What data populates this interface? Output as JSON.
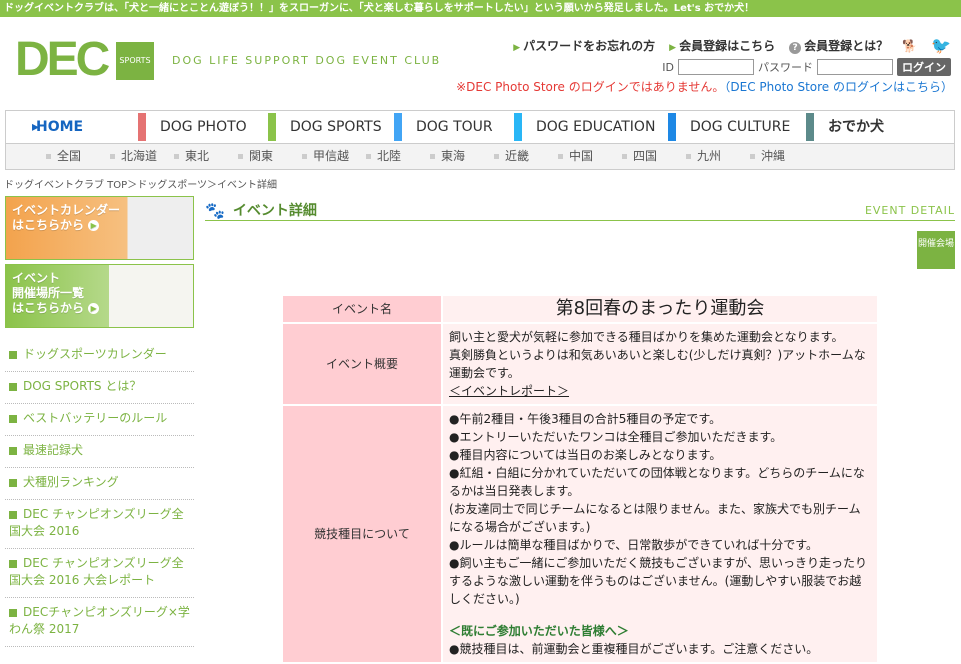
{
  "topbar": {
    "text": "ドッグイベントクラブは、「犬と一緒にとことん遊ぼう！！」をスローガンに、「犬と楽しむ暮らしをサポートしたい」という願いから発足しました。Let's おでか犬！"
  },
  "logo": {
    "main": "DEC",
    "badge": "SPORTS"
  },
  "tagline": "DOG LIFE SUPPORT DOG EVENT CLUB",
  "header": {
    "forgot": "パスワードをお忘れの方",
    "register": "会員登録はこちら",
    "what": "会員登録とは？",
    "id_label": "ID",
    "pw_label": "パスワード",
    "login": "ログイン",
    "warn_red": "※DEC Photo Store のログインではありません。",
    "warn_blue": "（DEC Photo Store のログインはこちら）"
  },
  "nav": {
    "items": [
      "HOME",
      "DOG PHOTO",
      "DOG SPORTS",
      "DOG TOUR",
      "DOG EDUCATION",
      "DOG CULTURE",
      "おでか犬"
    ],
    "regions": [
      "全国",
      "北海道",
      "東北",
      "関東",
      "甲信越",
      "北陸",
      "東海",
      "近畿",
      "中国",
      "四国",
      "九州",
      "沖縄"
    ]
  },
  "breadcrumb": "ドッグイベントクラブ TOP＞ドッグスポーツ＞イベント詳細",
  "banners": {
    "calendar_1": "イベントカレンダー",
    "calendar_2": "はこちらから",
    "venue_1": "イベント",
    "venue_2": "開催場所一覧",
    "venue_3": "はこちらから"
  },
  "sidebar": [
    "ドッグスポーツカレンダー",
    "DOG SPORTS とは？",
    "ベストバッテリーのルール",
    "最速記録犬",
    "犬種別ランキング",
    "DEC チャンピオンズリーグ全国大会 2016",
    "DEC チャンピオンズリーグ全国大会 2016 大会レポート",
    "DECチャンピオンズリーグ×学わん祭 2017"
  ],
  "main": {
    "title": "イベント詳細",
    "title_en": "EVENT DETAIL",
    "venue_badge": "開催会場"
  },
  "event": {
    "name_label": "イベント名",
    "name": "第8回春のまったり運動会",
    "summary_label": "イベント概要",
    "summary_1": "飼い主と愛犬が気軽に参加できる種目ばかりを集めた運動会となります。",
    "summary_2": "真剣勝負というよりは和気あいあいと楽しむ(少しだけ真剣？)アットホームな運動会です。",
    "summary_link": "＜イベントレポート＞",
    "events_label": "競技種目について",
    "e1": "●午前2種目・午後3種目の合計5種目の予定です。",
    "e2": "●エントリーいただいたワンコは全種目ご参加いただきます。",
    "e3": "●種目内容については当日のお楽しみとなります。",
    "e4": "●紅組・白組に分かれていただいての団体戦となります。どちらのチームになるかは当日発表します。",
    "e5": "(お友達同士で同じチームになるとは限りません。また、家族犬でも別チームになる場合がございます。)",
    "e6": "●ルールは簡単な種目ばかりで、日常散歩ができていれば十分です。",
    "e7": "●飼い主もご一緒にご参加いただく競技もございますが、思いっきり走ったりするような激しい運動を伴うものはございません。(運動しやすい服装でお越しください。)",
    "e8": "＜既にご参加いただいた皆様へ＞",
    "e9": "●競技種目は、前運動会と重複種目がございます。ご注意ください。"
  }
}
